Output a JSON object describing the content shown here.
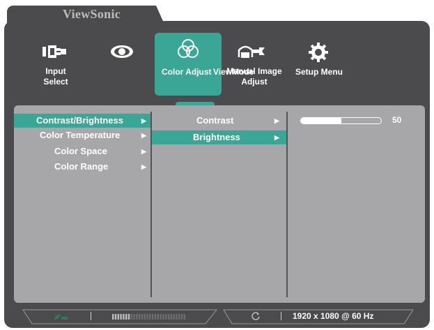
{
  "brand": "ViewSonic",
  "tabs": [
    {
      "label": "Input\nSelect",
      "icon": "input-select-icon"
    },
    {
      "label": "",
      "icon": "eye-icon"
    },
    {
      "label": "Color Adjust",
      "icon": "color-adjust-icon",
      "active": true
    },
    {
      "label": "ViewMode",
      "icon": "view-mode-icon"
    },
    {
      "label": "Manual Image\nAdjust",
      "icon": "manual-image-adjust-icon"
    },
    {
      "label": "Setup Menu",
      "icon": "gear-icon"
    }
  ],
  "menu_level1": [
    {
      "label": "Contrast/Brightness",
      "selected": true
    },
    {
      "label": "Color Temperature"
    },
    {
      "label": "Color Space"
    },
    {
      "label": "Color Range"
    }
  ],
  "menu_level2": [
    {
      "label": "Contrast"
    },
    {
      "label": "Brightness",
      "selected": true
    }
  ],
  "slider": {
    "value": "50",
    "level": 0.5
  },
  "status": {
    "resolution": "1920 x 1080 @ 60 Hz"
  },
  "colors": {
    "accent": "#3aa696",
    "frame": "#4b4b4d",
    "panel": "#a7a7a9"
  }
}
